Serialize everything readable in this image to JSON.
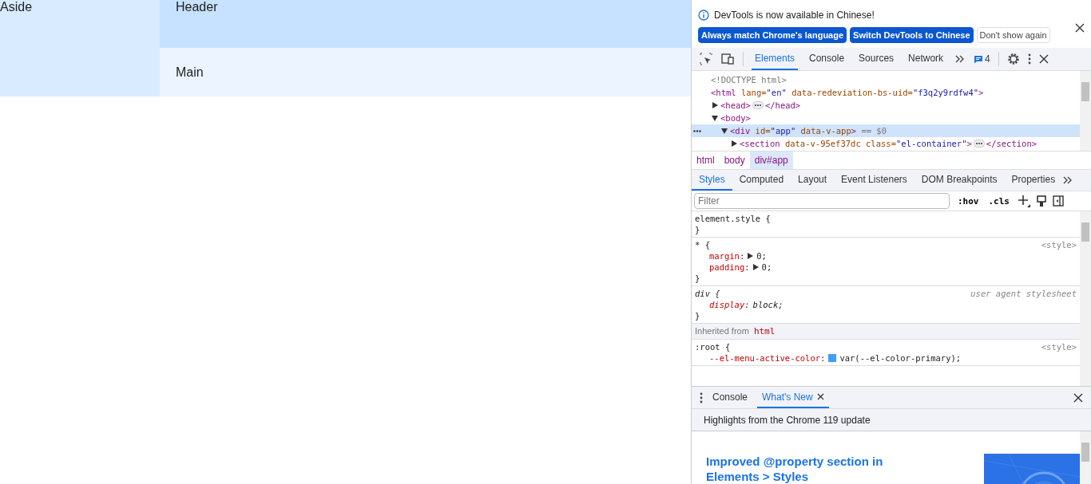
{
  "page": {
    "aside": "Aside",
    "header": "Header",
    "main": "Main"
  },
  "devtools": {
    "infobar": {
      "message": "DevTools is now available in Chinese!",
      "buttons": [
        {
          "label": "Always match Chrome's language",
          "kind": "primary"
        },
        {
          "label": "Switch DevTools to Chinese",
          "kind": "primary"
        },
        {
          "label": "Don't show again",
          "kind": "plain"
        }
      ]
    },
    "main_tabs": [
      {
        "label": "Elements",
        "selected": true
      },
      {
        "label": "Console",
        "selected": false
      },
      {
        "label": "Sources",
        "selected": false
      },
      {
        "label": "Network",
        "selected": false
      }
    ],
    "issues_count": "4",
    "dom_tree": [
      {
        "selected": false,
        "parts": [
          {
            "kind": "doctype",
            "text": "<!DOCTYPE html>"
          }
        ]
      },
      {
        "selected": false,
        "parts": [
          {
            "kind": "tag",
            "text": "<html"
          },
          {
            "kind": "attr",
            "text": " lang="
          },
          {
            "kind": "value",
            "text": "\"en\""
          },
          {
            "kind": "attr",
            "text": " data-redeviation-bs-uid="
          },
          {
            "kind": "value",
            "text": "\"f3q2y9rdfw4\""
          },
          {
            "kind": "tag",
            "text": ">"
          }
        ],
        "children": [
          {
            "selected": false,
            "expanded": false,
            "parts": [
              {
                "kind": "tag",
                "text": "<head>"
              },
              {
                "kind": "ellipsis"
              },
              {
                "kind": "tag",
                "text": "</head>"
              }
            ]
          },
          {
            "selected": false,
            "expanded": true,
            "parts": [
              {
                "kind": "tag",
                "text": "<body>"
              }
            ],
            "children": [
              {
                "selected": true,
                "expanded": true,
                "parts": [
                  {
                    "kind": "tag",
                    "text": "<div"
                  },
                  {
                    "kind": "attr",
                    "text": " id="
                  },
                  {
                    "kind": "value",
                    "text": "\"app\""
                  },
                  {
                    "kind": "attr",
                    "text": " data-v-app"
                  },
                  {
                    "kind": "tag",
                    "text": ">"
                  },
                  {
                    "kind": "ref",
                    "text": " == $0"
                  }
                ],
                "children": [
                  {
                    "selected": false,
                    "expanded": false,
                    "parts": [
                      {
                        "kind": "tag",
                        "text": "<section"
                      },
                      {
                        "kind": "attr",
                        "text": " data-v-95ef37dc class="
                      },
                      {
                        "kind": "value",
                        "text": "\"el-container\""
                      },
                      {
                        "kind": "tag",
                        "text": ">"
                      },
                      {
                        "kind": "ellipsis"
                      },
                      {
                        "kind": "tag",
                        "text": "</section>"
                      }
                    ]
                  }
                ]
              }
            ]
          }
        ]
      }
    ],
    "breadcrumbs": [
      {
        "label": "html",
        "selected": false
      },
      {
        "label": "body",
        "selected": false
      },
      {
        "label": "div#app",
        "selected": true
      }
    ],
    "sub_tabs": [
      {
        "label": "Styles",
        "selected": true
      },
      {
        "label": "Computed",
        "selected": false
      },
      {
        "label": "Layout",
        "selected": false
      },
      {
        "label": "Event Listeners",
        "selected": false
      },
      {
        "label": "DOM Breakpoints",
        "selected": false
      },
      {
        "label": "Properties",
        "selected": false
      }
    ],
    "filter": {
      "placeholder": "Filter"
    },
    "toggles": [
      ":hov",
      ".cls"
    ],
    "rules": [
      {
        "kind": "rule",
        "selector": "element.style {",
        "close": "}"
      },
      {
        "kind": "rule",
        "selector": "* {",
        "source": "<style>",
        "close": "}",
        "decls": [
          {
            "prop": "margin",
            "colon": ":",
            "value": "0;",
            "expandable": true
          },
          {
            "prop": "padding",
            "colon": ":",
            "value": "0;",
            "expandable": true
          }
        ]
      },
      {
        "kind": "user_agent",
        "selector": "div {",
        "source": "user agent stylesheet",
        "close": "}",
        "decls": [
          {
            "prop": "display",
            "colon": ":",
            "value": "block;",
            "expandable": false
          }
        ]
      },
      {
        "kind": "inherited",
        "label": "Inherited from",
        "element": "html"
      },
      {
        "kind": "rule",
        "selector": ":root {",
        "source": "<style>",
        "decls": [
          {
            "prop": "--el-menu-active-color",
            "colon": ":",
            "value": "var(--el-color-primary);",
            "expandable": false,
            "color": "#409eff"
          }
        ]
      }
    ],
    "drawer": {
      "tabs": [
        {
          "label": "Console",
          "selected": false,
          "closable": false
        },
        {
          "label": "What's New",
          "selected": true,
          "closable": true
        }
      ],
      "subtitle": "Highlights from the Chrome 119 update",
      "article_title": "Improved @property section in Elements > Styles"
    }
  }
}
